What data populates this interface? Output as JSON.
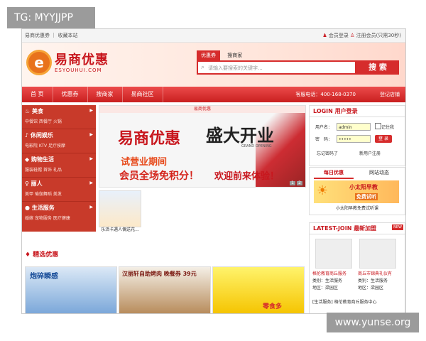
{
  "overlay": {
    "tag": "TG: MYYJJPP",
    "watermark": "www.yunse.org"
  },
  "topbar": {
    "left": "易商优惠券 ｜ 收藏本站",
    "member_login": "会员登录",
    "register": "注册会员(只需30秒)"
  },
  "logo": {
    "cn": "易商优惠",
    "en": "ESYOUHUI.COM"
  },
  "search": {
    "tab_coupons": "优惠券",
    "tab_merchants": "搜商家",
    "placeholder": "请输入要搜索的关键字...",
    "button": "搜 索"
  },
  "nav": {
    "items": [
      "首 页",
      "优惠券",
      "搜商家",
      "易商社区"
    ],
    "hotline": "客服电话：400-168-0370",
    "login": "登记店铺"
  },
  "sidebar": [
    {
      "title": "美食",
      "sub": "中餐馆 西餐厅 火锅"
    },
    {
      "title": "休闲娱乐",
      "sub": "电影院 KTV 足疗按摩"
    },
    {
      "title": "购物生活",
      "sub": "服装鞋帽 首饰 礼品"
    },
    {
      "title": "丽人",
      "sub": "美甲 瑜伽舞蹈 美发"
    },
    {
      "title": "生活服务",
      "sub": "婚嫁 宠物服务 医疗健康"
    }
  ],
  "banner": {
    "header": "易商优惠",
    "title": "易商优惠",
    "calligraphy": "盛大开业",
    "grand": "GRAND OPENING",
    "line1": "试营业期间",
    "line2": "会员全场免积分！",
    "line3": "欢迎前来体验！",
    "pages": [
      "1",
      "2"
    ]
  },
  "thumb": {
    "caption": "乐活卡遇人偶送花..."
  },
  "login": {
    "title": "LOGIN 用户登录",
    "username_label": "用户名：",
    "username_value": "admin",
    "password_label": "密　码：",
    "password_value": "•••••",
    "remember": "记住我",
    "button": "登 录",
    "forgot": "忘记密码了",
    "register": "新用户注册"
  },
  "news": {
    "tab_daily": "每日优惠",
    "tab_site": "网站动态",
    "card_title": "小太阳早教",
    "card_sub": "免费试听",
    "caption": "小太阳早教免费试听课"
  },
  "latest": {
    "title": "LATEST-JOIN 最新加盟",
    "new_badge": "NEW",
    "items": [
      {
        "name": "格伦教育商丘服务",
        "type": "类别：生活服务",
        "area": "地区：梁园区"
      },
      {
        "name": "商丘市锦典礼仪有",
        "type": "类别：生活服务",
        "area": "地区：梁园区"
      }
    ],
    "ticker": "[生活服务] 格伦教育商丘服务中心"
  },
  "featured": {
    "title": "精选优惠",
    "promos": [
      {
        "text": "炮碎瞬感"
      },
      {
        "text": "汉丽轩自助烤肉 晚餐券 39元"
      },
      {
        "text": "零食多"
      }
    ]
  }
}
